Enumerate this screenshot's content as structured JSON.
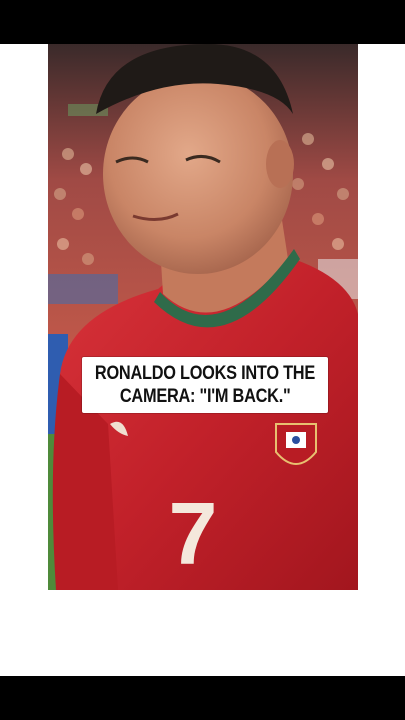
{
  "caption": {
    "line1": "RONALDO LOOKS INTO THE",
    "line2": "CAMERA: \"I'M BACK.\""
  },
  "jersey_number": "7",
  "colors": {
    "jersey_red": "#c8232c",
    "collar_green": "#2f6b4a",
    "crowd": "#b8463e",
    "background_white": "#ffffff",
    "bars_black": "#000000"
  }
}
